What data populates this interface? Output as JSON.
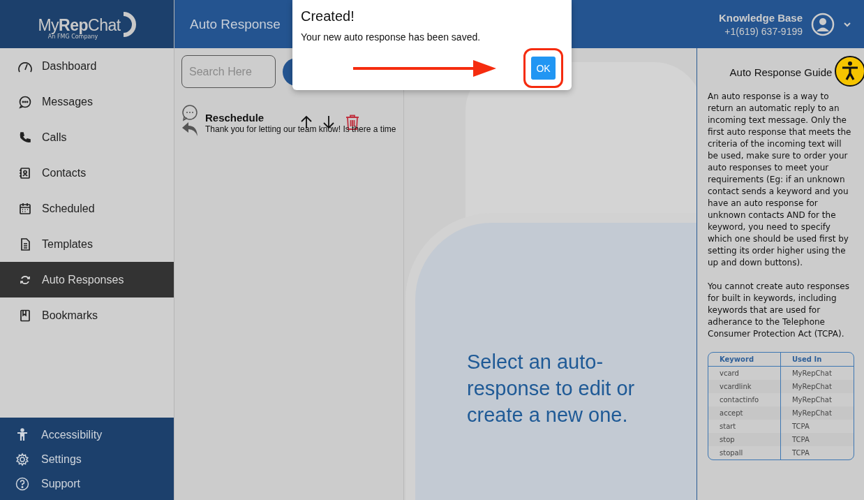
{
  "brand": {
    "logo": {
      "my": "My",
      "rep": "Rep",
      "chat": "Chat",
      "tagline": "An FMG Company"
    }
  },
  "sidebar": {
    "items": [
      {
        "label": "Dashboard",
        "selected": false
      },
      {
        "label": "Messages",
        "selected": false
      },
      {
        "label": "Calls",
        "selected": false
      },
      {
        "label": "Contacts",
        "selected": false
      },
      {
        "label": "Scheduled",
        "selected": false
      },
      {
        "label": "Templates",
        "selected": false
      },
      {
        "label": "Auto Responses",
        "selected": true
      },
      {
        "label": "Bookmarks",
        "selected": false
      }
    ],
    "footer_items": [
      {
        "label": "Accessibility"
      },
      {
        "label": "Settings"
      },
      {
        "label": "Support"
      }
    ]
  },
  "header": {
    "title": "Auto Response",
    "account_name": "Knowledge Base",
    "phone": "+1(619) 637-9199"
  },
  "search": {
    "placeholder": "Search Here"
  },
  "responses": [
    {
      "name": "Reschedule",
      "message": "Thank you for letting our team know! Is there a time"
    }
  ],
  "empty_state": {
    "text": "Select an auto-response to edit or create a new one."
  },
  "guide": {
    "title": "Auto Response Guide",
    "paragraphs": [
      "An auto response is a way to return an automatic reply to an incoming text message. Only the first auto response that meets the criteria of the incoming text will be used, make sure to order your auto responses to meet your requirements (Eg: if an unknown contact sends a keyword and you have an auto response for unknown contacts AND for the keyword, you need to specify which one should be used first by setting its order higher using the up and down buttons).",
      "You cannot create auto responses for built in keywords, including keywords that are used for adherance to the Telephone Consumer Protection Act (TCPA)."
    ],
    "table": {
      "columns": [
        "Keyword",
        "Used In"
      ],
      "rows": [
        [
          "vcard",
          "MyRepChat"
        ],
        [
          "vcardlink",
          "MyRepChat"
        ],
        [
          "contactinfo",
          "MyRepChat"
        ],
        [
          "accept",
          "MyRepChat"
        ],
        [
          "start",
          "TCPA"
        ],
        [
          "stop",
          "TCPA"
        ],
        [
          "stopall",
          "TCPA"
        ]
      ]
    }
  },
  "dialog": {
    "title": "Created!",
    "message": "Your new auto response has been saved.",
    "button": "OK"
  }
}
